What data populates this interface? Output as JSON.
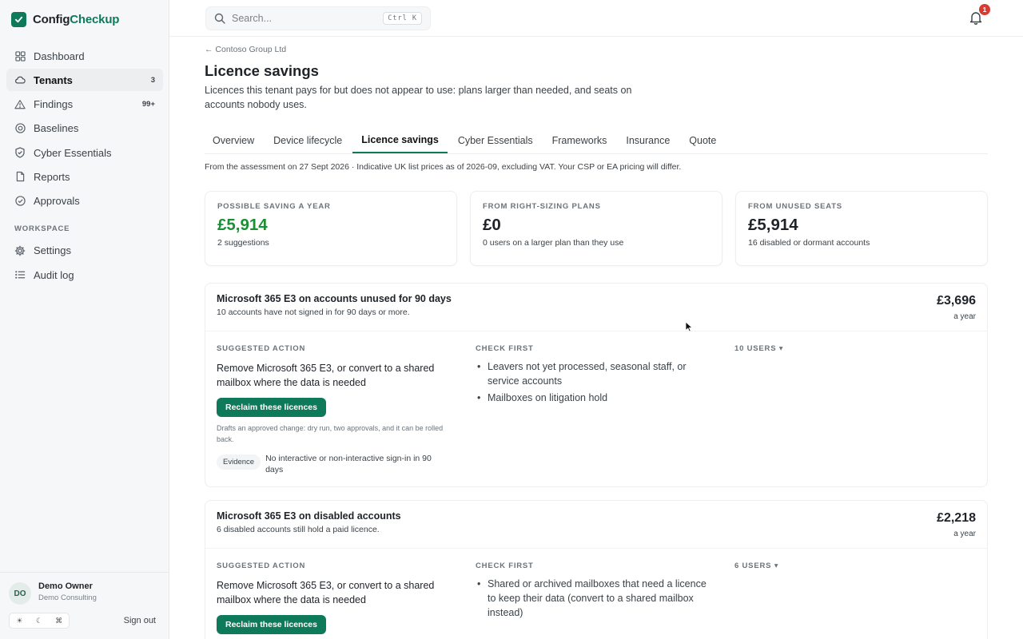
{
  "app": {
    "brand_prefix": "Config",
    "brand_suffix": "Checkup"
  },
  "sidebar": {
    "items": [
      {
        "label": "Dashboard",
        "icon": "grid-icon",
        "count": ""
      },
      {
        "label": "Tenants",
        "icon": "cloud-icon",
        "count": "3"
      },
      {
        "label": "Findings",
        "icon": "warning-triangle-icon",
        "count": "99+"
      },
      {
        "label": "Baselines",
        "icon": "target-icon",
        "count": ""
      },
      {
        "label": "Cyber Essentials",
        "icon": "shield-check-icon",
        "count": ""
      },
      {
        "label": "Reports",
        "icon": "document-icon",
        "count": ""
      },
      {
        "label": "Approvals",
        "icon": "check-circle-icon",
        "count": ""
      }
    ],
    "workspace_label": "WORKSPACE",
    "workspace_items": [
      {
        "label": "Settings",
        "icon": "gear-icon"
      },
      {
        "label": "Audit log",
        "icon": "list-icon"
      }
    ],
    "user": {
      "initials": "DO",
      "name": "Demo Owner",
      "org": "Demo Consulting"
    },
    "signout": "Sign out"
  },
  "topbar": {
    "search_placeholder": "Search...",
    "shortcut": "Ctrl K",
    "notifications": "1"
  },
  "page": {
    "breadcrumb": "← Contoso Group Ltd",
    "title": "Licence savings",
    "description": "Licences this tenant pays for but does not appear to use: plans larger than needed, and seats on accounts nobody uses.",
    "tabs": [
      "Overview",
      "Device lifecycle",
      "Licence savings",
      "Cyber Essentials",
      "Frameworks",
      "Insurance",
      "Quote"
    ],
    "active_tab": "Licence savings",
    "note": "From the assessment on 27 Sept 2026 · Indicative UK list prices as of 2026-09, excluding VAT. Your CSP or EA pricing will differ."
  },
  "stats": [
    {
      "label": "POSSIBLE SAVING A YEAR",
      "value": "£5,914",
      "sub": "2 suggestions",
      "color": "#1a8f34"
    },
    {
      "label": "FROM RIGHT-SIZING PLANS",
      "value": "£0",
      "sub": "0 users on a larger plan than they use"
    },
    {
      "label": "FROM UNUSED SEATS",
      "value": "£5,914",
      "sub": "16 disabled or dormant accounts"
    }
  ],
  "cards": [
    {
      "title": "Microsoft 365 E3 on accounts unused for 90 days",
      "subtitle": "10 accounts have not signed in for 90 days or more.",
      "amount": "£3,696",
      "per": "a year",
      "action_label": "SUGGESTED ACTION",
      "action_text": "Remove Microsoft 365 E3, or convert to a shared mailbox where the data is needed",
      "button": "Reclaim these licences",
      "button_note": "Drafts an approved change: dry run, two approvals, and it can be rolled back.",
      "evidence_tag": "Evidence",
      "evidence_text": "No interactive or non-interactive sign-in in 90 days",
      "check_label": "CHECK FIRST",
      "checks": [
        "Leavers not yet processed, seasonal staff, or service accounts",
        "Mailboxes on litigation hold"
      ],
      "users": "10 USERS ▾"
    },
    {
      "title": "Microsoft 365 E3 on disabled accounts",
      "subtitle": "6 disabled accounts still hold a paid licence.",
      "amount": "£2,218",
      "per": "a year",
      "action_label": "SUGGESTED ACTION",
      "action_text": "Remove Microsoft 365 E3, or convert to a shared mailbox where the data is needed",
      "button": "Reclaim these licences",
      "check_label": "CHECK FIRST",
      "checks": [
        "Shared or archived mailboxes that need a licence to keep their data (convert to a shared mailbox instead)"
      ],
      "users": "6 USERS ▾"
    }
  ],
  "colors": {
    "accent": "#0f7a5a",
    "saving_green": "#1a8f34",
    "badge_red": "#d93b30"
  }
}
